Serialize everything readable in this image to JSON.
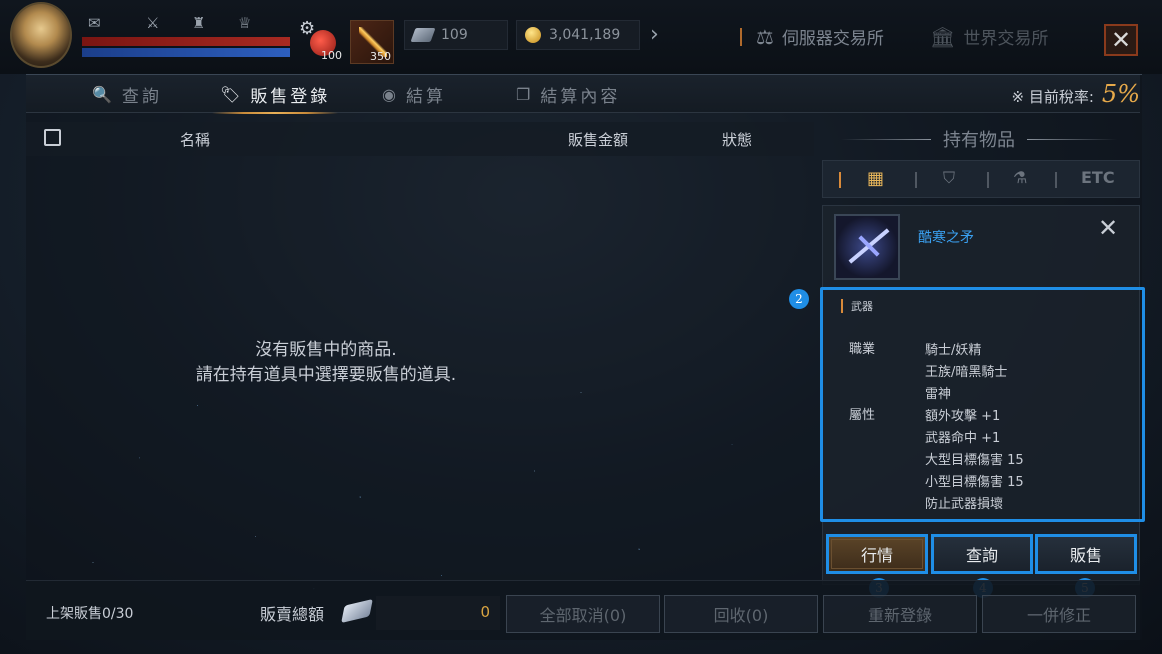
{
  "hud": {
    "shop_icon": "bag-icon",
    "potion_count": "100",
    "weapon_count": "350",
    "diamond_count": "109",
    "gold_count": "3,041,189",
    "server_exchange": "伺服器交易所",
    "world_exchange": "世界交易所"
  },
  "tabs": [
    {
      "label": "查詢",
      "icon": "search-icon"
    },
    {
      "label": "販售登錄",
      "icon": "tag-icon"
    },
    {
      "label": "結算",
      "icon": "coins-icon"
    },
    {
      "label": "結算內容",
      "icon": "document-icon"
    }
  ],
  "tax": {
    "label": "※ 目前稅率:",
    "value": "5%"
  },
  "list": {
    "col_name": "名稱",
    "col_price": "販售金額",
    "col_status": "狀態",
    "empty_line1": "沒有販售中的商品.",
    "empty_line2": "請在持有道具中選擇要販售的道具."
  },
  "owned": {
    "title": "持有物品",
    "filter_etc": "ETC",
    "item_name": "酷寒之矛",
    "category": "武器",
    "job_label": "職業",
    "jobs": [
      "騎士/妖精",
      "王族/暗黑騎士",
      "雷神"
    ],
    "attr_label": "屬性",
    "attrs": [
      "額外攻擊 +1",
      "武器命中 +1",
      "大型目標傷害 15",
      "小型目標傷害 15",
      "防止武器損壞"
    ]
  },
  "actions": {
    "market": "行情",
    "query": "查詢",
    "sell": "販售"
  },
  "badges": {
    "b2": "2",
    "b3": "3",
    "b4": "4",
    "b5": "5"
  },
  "footer": {
    "count": "上架販售0/30",
    "total_label": "販賣總額",
    "total_value": "0",
    "cancel_all": "全部取消(0)",
    "retrieve": "回收(0)",
    "relist": "重新登錄",
    "batch_edit": "一併修正"
  },
  "colors": {
    "accent": "#1f8ee6",
    "gold": "#e6a94a",
    "item_name": "#3aa0f0"
  }
}
